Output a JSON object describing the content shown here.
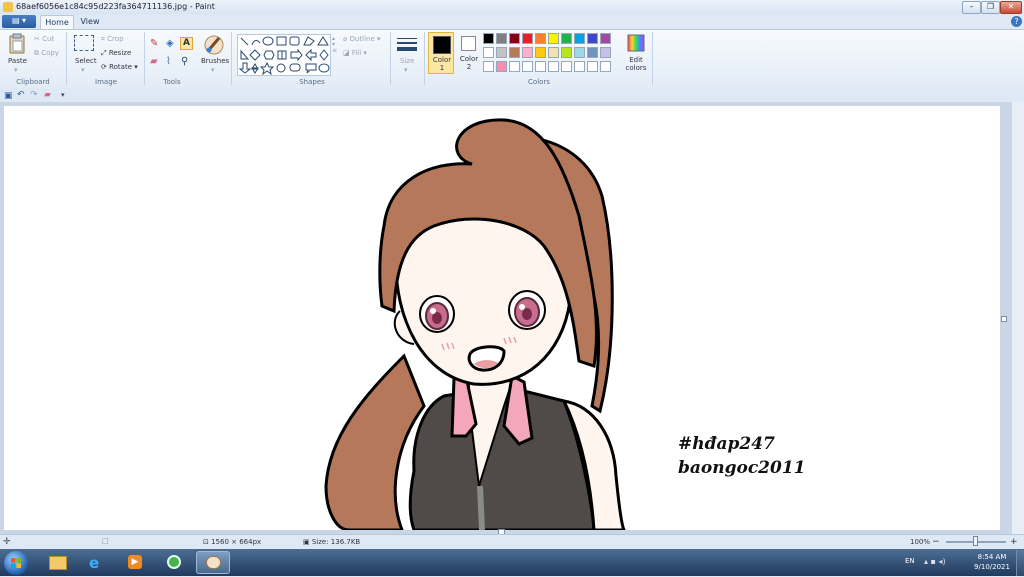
{
  "window": {
    "title": "68aef6056e1c84c95d223fa364711136.jpg - Paint",
    "minimize_symbol": "–",
    "maximize_symbol": "❐",
    "close_symbol": "✕",
    "help_symbol": "?"
  },
  "tabs": {
    "file_icon": "menu-icon",
    "home": "Home",
    "view": "View"
  },
  "clipboard": {
    "paste": "Paste",
    "cut": "Cut",
    "copy": "Copy",
    "group": "Clipboard"
  },
  "image": {
    "select": "Select",
    "crop": "Crop",
    "resize": "Resize",
    "rotate": "Rotate",
    "group": "Image"
  },
  "tools": {
    "group": "Tools",
    "text_tool_glyph": "A"
  },
  "brushes": {
    "label": "Brushes"
  },
  "shapes": {
    "outline": "Outline",
    "fill": "Fill",
    "group": "Shapes"
  },
  "size": {
    "label": "Size"
  },
  "colors": {
    "color1_label": "Color 1",
    "color2_label": "Color 2",
    "color1_value": "#000000",
    "color2_value": "#ffffff",
    "edit_label": "Edit colors",
    "group": "Colors",
    "palette_row1": [
      "#000000",
      "#7f7f7f",
      "#880015",
      "#ed1c24",
      "#ff7f27",
      "#fff200",
      "#22b14c",
      "#00a2e8",
      "#3f48cc",
      "#a349a4"
    ],
    "palette_row2": [
      "#ffffff",
      "#c3c3c3",
      "#b97a57",
      "#ffaec9",
      "#ffc90e",
      "#efe4b0",
      "#b5e61d",
      "#99d9ea",
      "#7092be",
      "#c8bfe7"
    ],
    "palette_row3": [
      "#ffffff",
      "#f48fb1",
      "#ffffff",
      "#ffffff",
      "#ffffff",
      "#ffffff",
      "#ffffff",
      "#ffffff",
      "#ffffff",
      "#ffffff"
    ]
  },
  "canvas": {
    "watermark_line1": "#hđap247",
    "watermark_line2": "baongoc2011",
    "hair_color": "#b5785a",
    "skin_color": "#fdf5ee",
    "shirt_color": "#504a48",
    "collar_color": "#f4a7bb",
    "eye_color": "#c86d8e"
  },
  "status": {
    "dimensions": "1560 × 664px",
    "size": "Size: 136.7KB",
    "zoom": "100%",
    "zoom_minus": "−",
    "zoom_plus": "+"
  },
  "taskbar": {
    "language": "EN",
    "time": "8:54 AM",
    "date": "9/10/2021"
  }
}
